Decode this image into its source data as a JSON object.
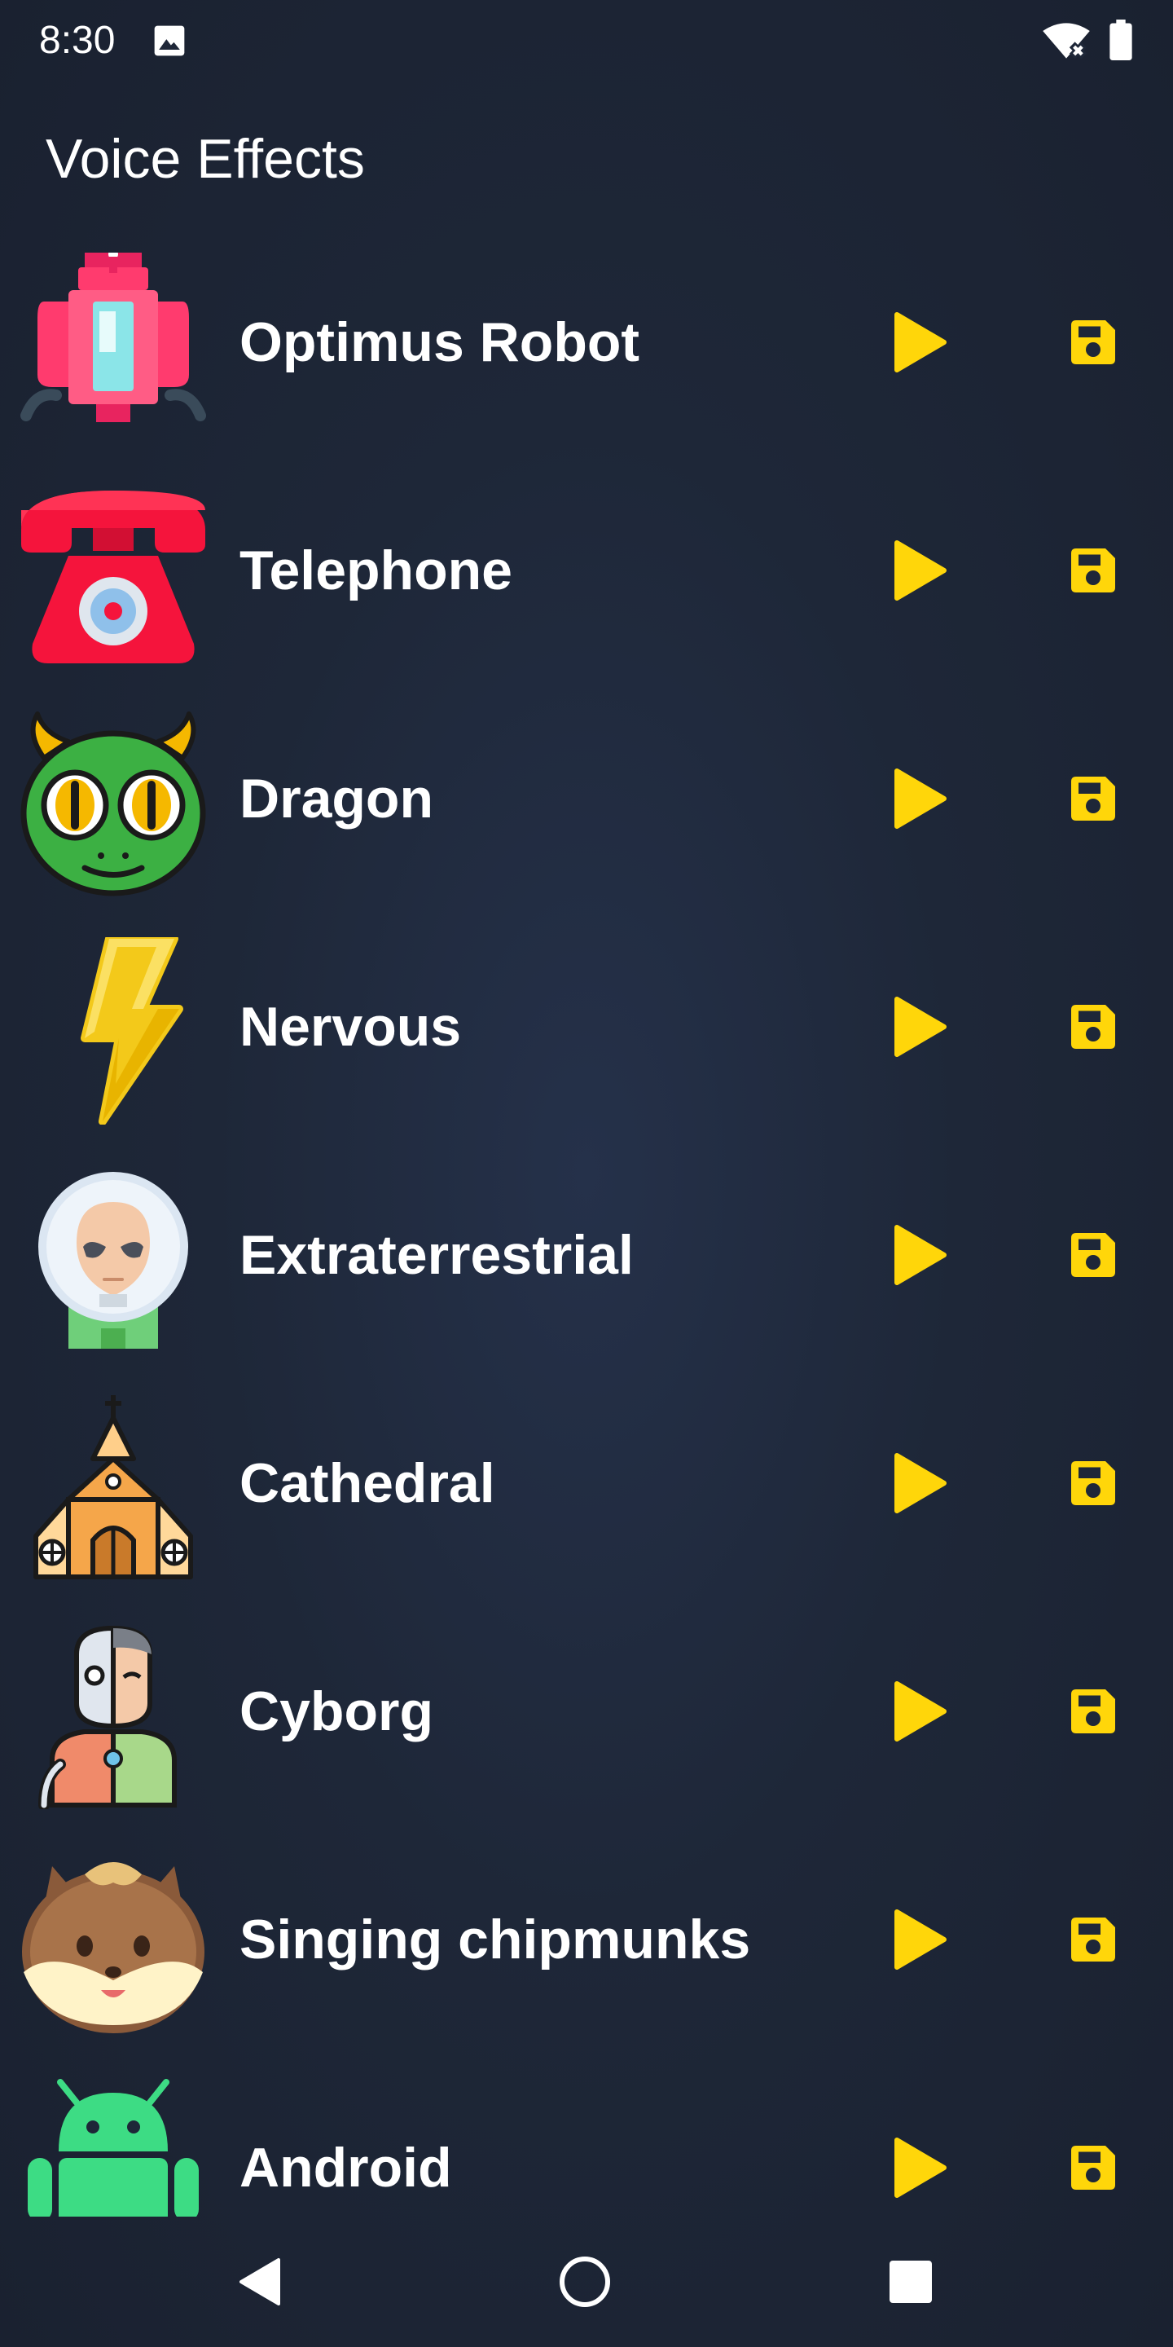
{
  "status_bar": {
    "time": "8:30",
    "icons": [
      "image-icon",
      "wifi-off-icon",
      "battery-icon"
    ]
  },
  "page": {
    "title": "Voice Effects"
  },
  "colors": {
    "accent": "#FFD60A",
    "background": "#1E2738",
    "text": "#FFFFFF"
  },
  "effects": [
    {
      "label": "Optimus Robot",
      "icon": "robot-icon"
    },
    {
      "label": "Telephone",
      "icon": "telephone-icon"
    },
    {
      "label": "Dragon",
      "icon": "dragon-icon"
    },
    {
      "label": "Nervous",
      "icon": "lightning-icon"
    },
    {
      "label": "Extraterrestrial",
      "icon": "alien-icon"
    },
    {
      "label": "Cathedral",
      "icon": "cathedral-icon"
    },
    {
      "label": "Cyborg",
      "icon": "cyborg-icon"
    },
    {
      "label": "Singing chipmunks",
      "icon": "chipmunk-icon"
    },
    {
      "label": "Android",
      "icon": "android-icon"
    }
  ],
  "row_actions": {
    "play_icon": "play-icon",
    "save_icon": "floppy-disk-icon"
  },
  "nav_bar": {
    "icons": [
      "back-icon",
      "home-icon",
      "recents-icon"
    ]
  }
}
